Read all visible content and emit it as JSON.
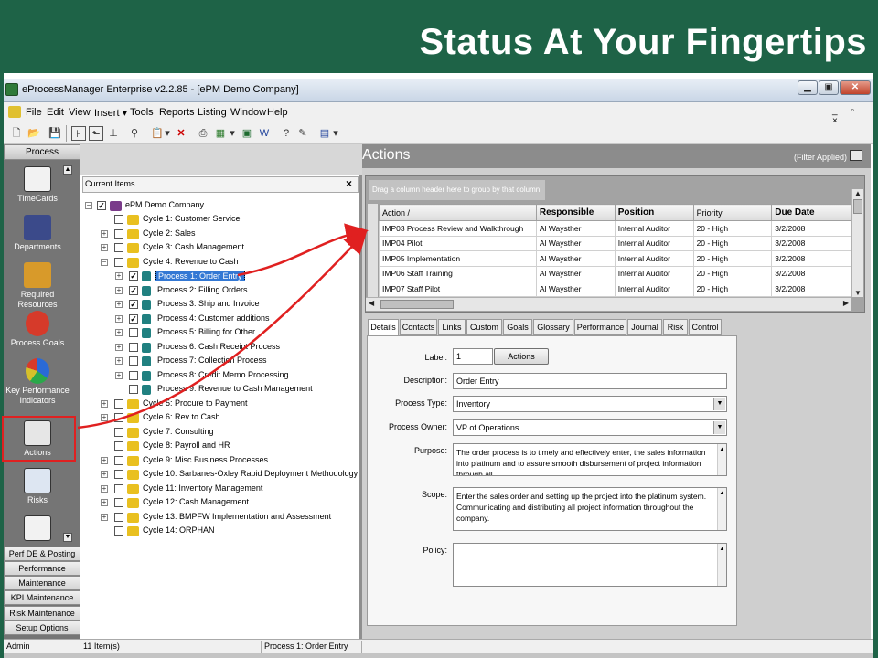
{
  "slide": {
    "title": "Status At Your Fingertips"
  },
  "window": {
    "title": "eProcessManager Enterprise v2.2.85 - [ePM Demo Company]",
    "buttons": {
      "minimize": "▁",
      "maximize": "▣",
      "close": "✕"
    },
    "mdi_controls": "_ ▫ ×"
  },
  "menu": [
    "File",
    "Edit",
    "View",
    "Insert ▾",
    "Tools",
    "Reports",
    "Listing",
    "Window",
    "Help"
  ],
  "nav": {
    "header": "Process",
    "items": [
      {
        "label": "TimeCards",
        "icon": "timecard-icon"
      },
      {
        "label": "Departments",
        "icon": "departments-icon"
      },
      {
        "label": "Required Resources",
        "icon": "resources-icon"
      },
      {
        "label": "Process Goals",
        "icon": "goals-icon"
      },
      {
        "label": "Key Performance Indicators",
        "icon": "kpi-icon"
      },
      {
        "label": "Actions",
        "icon": "actions-icon"
      },
      {
        "label": "Risks",
        "icon": "risks-icon"
      }
    ],
    "bottom_buttons": [
      "Perf DE & Posting",
      "Performance",
      "Maintenance",
      "KPI Maintenance",
      "Risk Maintenance",
      "Setup Options"
    ]
  },
  "tree": {
    "header": "Current Items",
    "close": "×",
    "root": "ePM Demo Company",
    "nodes": [
      {
        "label": "Cycle 1: Customer Service",
        "level": 1,
        "expand": false,
        "checked": false
      },
      {
        "label": "Cycle 2: Sales",
        "level": 1,
        "expand": true,
        "checked": false
      },
      {
        "label": "Cycle 3: Cash Management",
        "level": 1,
        "expand": true,
        "checked": false
      },
      {
        "label": "Cycle 4: Revenue to Cash",
        "level": 1,
        "expand": "open",
        "checked": false
      },
      {
        "label": "Process 1: Order Entry",
        "level": 2,
        "expand": true,
        "checked": true,
        "selected": true
      },
      {
        "label": "Process 2: Filling Orders",
        "level": 2,
        "expand": true,
        "checked": true
      },
      {
        "label": "Process 3: Ship and Invoice",
        "level": 2,
        "expand": true,
        "checked": true
      },
      {
        "label": "Process 4: Customer additions",
        "level": 2,
        "expand": true,
        "checked": true
      },
      {
        "label": "Process 5: Billing for Other",
        "level": 2,
        "expand": true,
        "checked": false
      },
      {
        "label": "Process 6: Cash Receipt Process",
        "level": 2,
        "expand": true,
        "checked": false
      },
      {
        "label": "Process 7: Collection Process",
        "level": 2,
        "expand": true,
        "checked": false
      },
      {
        "label": "Process 8: Credit Memo Processing",
        "level": 2,
        "expand": true,
        "checked": false
      },
      {
        "label": "Process 9: Revenue to Cash Management",
        "level": 2,
        "expand": false,
        "checked": false
      },
      {
        "label": "Cycle 5: Procure to Payment",
        "level": 1,
        "expand": true,
        "checked": false
      },
      {
        "label": "Cycle 6: Rev to Cash",
        "level": 1,
        "expand": true,
        "checked": false
      },
      {
        "label": "Cycle 7: Consulting",
        "level": 1,
        "expand": false,
        "checked": false
      },
      {
        "label": "Cycle 8: Payroll and HR",
        "level": 1,
        "expand": false,
        "checked": false
      },
      {
        "label": "Cycle 9: Misc Business Processes",
        "level": 1,
        "expand": true,
        "checked": false
      },
      {
        "label": "Cycle 10: Sarbanes-Oxley Rapid Deployment Methodology",
        "level": 1,
        "expand": true,
        "checked": false
      },
      {
        "label": "Cycle 11: Inventory Management",
        "level": 1,
        "expand": true,
        "checked": false
      },
      {
        "label": "Cycle 12: Cash Management",
        "level": 1,
        "expand": true,
        "checked": false
      },
      {
        "label": "Cycle 13: BMPFW Implementation and Assessment",
        "level": 1,
        "expand": true,
        "checked": false
      },
      {
        "label": "Cycle 14: ORPHAN",
        "level": 1,
        "expand": false,
        "checked": false
      }
    ]
  },
  "actions": {
    "title": "Actions",
    "filter": "(Filter Applied)",
    "group_hint": "Drag a column header here to group by that column.",
    "columns": [
      "Action /",
      "Responsible",
      "Position",
      "Priority",
      "Due Date"
    ],
    "rows": [
      [
        "IMP03 Process Review and Walkthrough",
        "Al Waysther",
        "Internal Auditor",
        "20 - High",
        "3/2/2008"
      ],
      [
        "IMP04 Pilot",
        "Al Waysther",
        "Internal Auditor",
        "20 - High",
        "3/2/2008"
      ],
      [
        "IMP05 Implementation",
        "Al Waysther",
        "Internal Auditor",
        "20 - High",
        "3/2/2008"
      ],
      [
        "IMP06 Staff Training",
        "Al Waysther",
        "Internal Auditor",
        "20 - High",
        "3/2/2008"
      ],
      [
        "IMP07 Staff Pilot",
        "Al Waysther",
        "Internal Auditor",
        "20 - High",
        "3/2/2008"
      ]
    ]
  },
  "tabs": [
    "Details",
    "Contacts",
    "Links",
    "Custom",
    "Goals",
    "Glossary",
    "Performance",
    "Journal",
    "Risk",
    "Control"
  ],
  "details": {
    "label_label": "Label:",
    "label_value": "1",
    "actions_button": "Actions",
    "description_label": "Description:",
    "description_value": "Order Entry",
    "process_type_label": "Process Type:",
    "process_type_value": "Inventory",
    "process_owner_label": "Process Owner:",
    "process_owner_value": "VP of Operations",
    "purpose_label": "Purpose:",
    "purpose_value": "The order process is to timely and effectively enter, the sales information into platinum and to assure smooth disbursement of project information through all",
    "scope_label": "Scope:",
    "scope_value": "Enter the sales order and  setting up the project into the platinum system. Communicating and distributing all project information throughout the company.",
    "policy_label": "Policy:",
    "policy_value": ""
  },
  "status": {
    "user": "Admin",
    "count": "11 Item(s)",
    "current": "Process 1: Order Entry"
  },
  "colors": {
    "banner": "#1e6347",
    "selection": "#3378d4",
    "arrow": "#e02020",
    "nav": "#757575"
  }
}
